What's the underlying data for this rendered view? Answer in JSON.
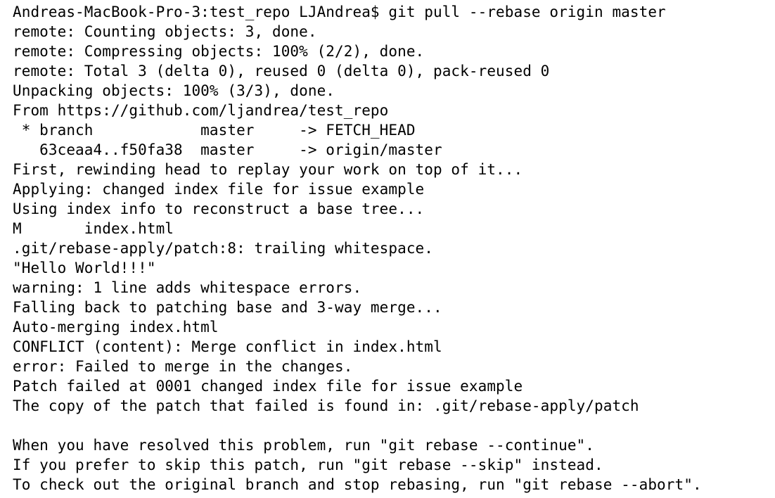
{
  "terminal": {
    "lines": [
      "Andreas-MacBook-Pro-3:test_repo LJAndrea$ git pull --rebase origin master",
      "remote: Counting objects: 3, done.",
      "remote: Compressing objects: 100% (2/2), done.",
      "remote: Total 3 (delta 0), reused 0 (delta 0), pack-reused 0",
      "Unpacking objects: 100% (3/3), done.",
      "From https://github.com/ljandrea/test_repo",
      " * branch            master     -> FETCH_HEAD",
      "   63ceaa4..f50fa38  master     -> origin/master",
      "First, rewinding head to replay your work on top of it...",
      "Applying: changed index file for issue example",
      "Using index info to reconstruct a base tree...",
      "M       index.html",
      ".git/rebase-apply/patch:8: trailing whitespace.",
      "\"Hello World!!!\"",
      "warning: 1 line adds whitespace errors.",
      "Falling back to patching base and 3-way merge...",
      "Auto-merging index.html",
      "CONFLICT (content): Merge conflict in index.html",
      "error: Failed to merge in the changes.",
      "Patch failed at 0001 changed index file for issue example",
      "The copy of the patch that failed is found in: .git/rebase-apply/patch",
      "",
      "When you have resolved this problem, run \"git rebase --continue\".",
      "If you prefer to skip this patch, run \"git rebase --skip\" instead.",
      "To check out the original branch and stop rebasing, run \"git rebase --abort\"."
    ]
  }
}
